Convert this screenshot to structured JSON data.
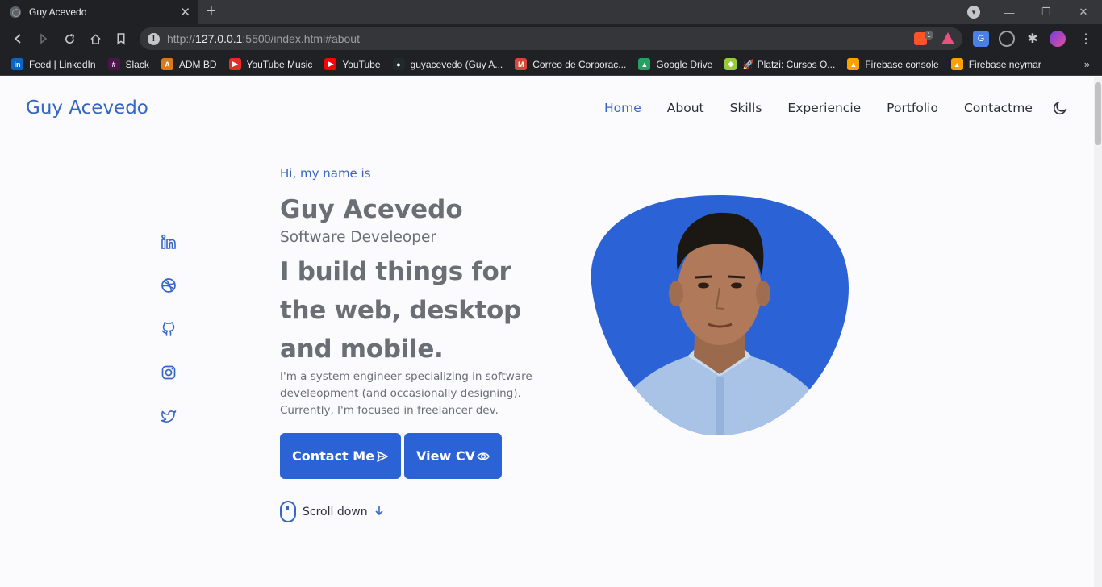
{
  "browser": {
    "tab_title": "Guy Acevedo",
    "tab_close": "✕",
    "new_tab": "+",
    "url_host": "127.0.0.1",
    "url_prefix": "http://",
    "url_suffix": ":5500/index.html#about",
    "brave_count": "1",
    "bookmarks": [
      {
        "label": "Feed | LinkedIn",
        "icon": "in",
        "color": "#0a66c2"
      },
      {
        "label": "Slack",
        "icon": "#",
        "color": "#4a154b"
      },
      {
        "label": "ADM BD",
        "icon": "A",
        "color": "#d97b1c"
      },
      {
        "label": "YouTube Music",
        "icon": "▶",
        "color": "#e52d27"
      },
      {
        "label": "YouTube",
        "icon": "▶",
        "color": "#ff0000"
      },
      {
        "label": "guyacevedo (Guy A...",
        "icon": "●",
        "color": "#24292e"
      },
      {
        "label": "Correo de Corporac...",
        "icon": "M",
        "color": "#d44638"
      },
      {
        "label": "Google Drive",
        "icon": "▲",
        "color": "#1fa463"
      },
      {
        "label": "🚀 Platzi: Cursos O...",
        "icon": "◆",
        "color": "#98ca3f"
      },
      {
        "label": "Firebase console",
        "icon": "▲",
        "color": "#ffa000"
      },
      {
        "label": "Firebase neymar",
        "icon": "▲",
        "color": "#ffa000"
      }
    ],
    "more": "»"
  },
  "site": {
    "logo": "Guy Acevedo",
    "nav": [
      "Home",
      "About",
      "Skills",
      "Experiencie",
      "Portfolio",
      "Contactme"
    ],
    "hello": "Hi, my name is",
    "name": "Guy Acevedo",
    "role": "Software Develeoper",
    "headline": "I build things for the web, desktop and mobile.",
    "description": "I'm a system engineer specializing in software develeopment (and occasionally designing). Currently, I'm focused in freelancer dev.",
    "btn_contact": "Contact Me",
    "btn_cv": "View CV",
    "scroll": "Scroll down",
    "accent": "#2b63d6"
  }
}
